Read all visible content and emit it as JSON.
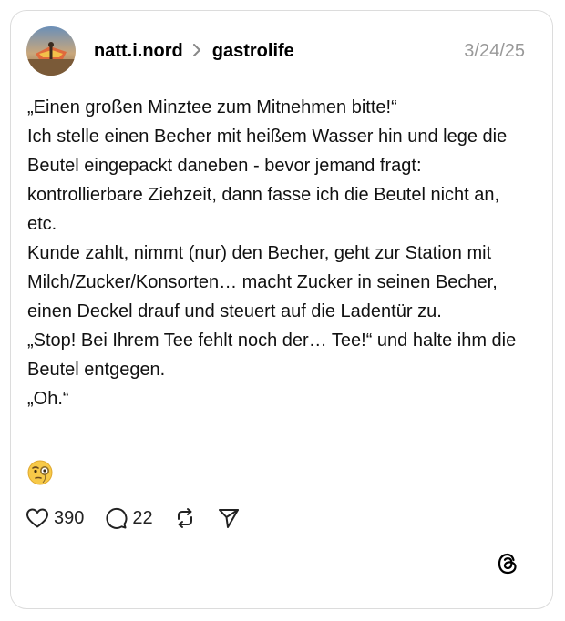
{
  "post": {
    "author": "natt.i.nord",
    "separator_icon": "chevron-right-icon",
    "community": "gastrolife",
    "date": "3/24/25",
    "text": "„Einen großen Minztee zum Mitnehmen bitte!“\nIch stelle einen Becher mit heißem Wasser hin und lege die Beutel eingepackt daneben - bevor jemand fragt: kontrollierbare Ziehzeit,  dann fasse ich die Beutel nicht an, etc.\nKunde zahlt, nimmt (nur) den Becher, geht zur Station mit Milch/Zucker/Konsorten… macht Zucker in seinen Becher, einen Deckel drauf und steuert auf die Ladentür zu.\n„Stop! Bei Ihrem Tee fehlt noch der… Tee!“ und halte ihm die Beutel entgegen.\n„Oh.“",
    "emoji": "face-with-monocle-icon"
  },
  "actions": {
    "likes": "390",
    "comments": "22",
    "like_icon": "heart-icon",
    "comment_icon": "comment-bubble-icon",
    "repost_icon": "repost-icon",
    "share_icon": "send-icon"
  },
  "branding": {
    "logo": "threads-logo-icon"
  }
}
